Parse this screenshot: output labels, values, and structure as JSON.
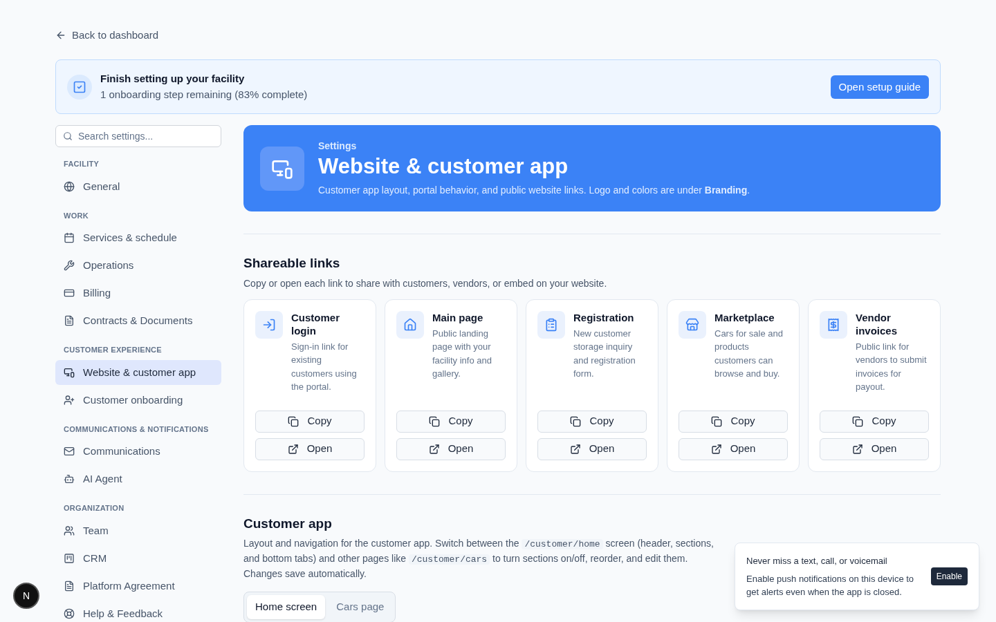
{
  "back_link": "Back to dashboard",
  "setup_banner": {
    "title": "Finish setting up your facility",
    "subtitle": "1 onboarding step remaining (83% complete)",
    "button": "Open setup guide"
  },
  "sidebar": {
    "search": {
      "placeholder": "Search settings..."
    },
    "groups": [
      {
        "heading": "FACILITY",
        "items": [
          {
            "label": "General",
            "selected": false
          }
        ]
      },
      {
        "heading": "WORK",
        "items": [
          {
            "label": "Services & schedule",
            "selected": false
          },
          {
            "label": "Operations",
            "selected": false
          },
          {
            "label": "Billing",
            "selected": false
          },
          {
            "label": "Contracts & Documents",
            "selected": false
          }
        ]
      },
      {
        "heading": "CUSTOMER EXPERIENCE",
        "items": [
          {
            "label": "Website & customer app",
            "selected": true
          },
          {
            "label": "Customer onboarding",
            "selected": false
          }
        ]
      },
      {
        "heading": "COMMUNICATIONS & NOTIFICATIONS",
        "items": [
          {
            "label": "Communications",
            "selected": false
          },
          {
            "label": "AI Agent",
            "selected": false
          }
        ]
      },
      {
        "heading": "ORGANIZATION",
        "items": [
          {
            "label": "Team",
            "selected": false
          },
          {
            "label": "CRM",
            "selected": false
          },
          {
            "label": "Platform Agreement",
            "selected": false
          },
          {
            "label": "Help & Feedback",
            "selected": false
          }
        ]
      }
    ]
  },
  "header": {
    "eyebrow": "Settings",
    "title": "Website & customer app",
    "description": "Customer app layout, portal behavior, and public website links. Logo and colors are under **Branding**."
  },
  "shareable_links": {
    "title": "Shareable links",
    "description": "Copy or open each link to share with customers, vendors, or embed on your website.",
    "cards": [
      {
        "title": "Customer login",
        "description": "Sign-in link for existing customers using the portal.",
        "copy": "Copy",
        "open": "Open"
      },
      {
        "title": "Main page",
        "description": "Public landing page with your facility info and gallery.",
        "copy": "Copy",
        "open": "Open"
      },
      {
        "title": "Registration",
        "description": "New customer storage inquiry and registration form.",
        "copy": "Copy",
        "open": "Open"
      },
      {
        "title": "Marketplace",
        "description": "Cars for sale and products customers can browse and buy.",
        "copy": "Copy",
        "open": "Open"
      },
      {
        "title": "Vendor invoices",
        "description": "Public link for vendors to submit invoices for payout.",
        "copy": "Copy",
        "open": "Open"
      }
    ]
  },
  "customer_app": {
    "title": "Customer app",
    "description": [
      {
        "kind": "text",
        "text": "Layout and navigation for the customer app. Switch between the "
      },
      {
        "kind": "code",
        "text": "/customer/home"
      },
      {
        "kind": "text",
        "text": " screen (header, sections, and bottom tabs) and other pages like "
      },
      {
        "kind": "code",
        "text": "/customer/cars"
      },
      {
        "kind": "text",
        "text": " to turn sections on/off, reorder, and edit them. Changes save automatically."
      }
    ],
    "tabs": [
      {
        "label": "Home screen",
        "selected": true
      },
      {
        "label": "Cars page",
        "selected": false
      }
    ]
  },
  "toast": {
    "title": "Never miss a text, call, or voicemail",
    "body": "Enable push notifications on this device to get alerts even when the app is closed.",
    "button": "Enable"
  },
  "dev_badge": "N"
}
